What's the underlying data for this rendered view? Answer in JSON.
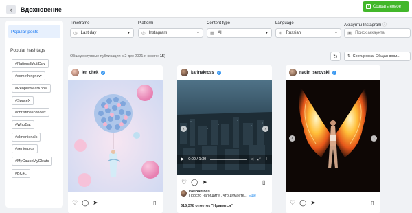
{
  "header": {
    "title": "Вдохновение",
    "create_label": "Создать новое"
  },
  "sidebar": {
    "popular_posts": "Popular posts",
    "hashtags_title": "Popular hashtags",
    "hashtags": [
      "#NationalMuttDay",
      "#somethingnew",
      "#PeopleWearKnow",
      "#SpaceX",
      "#christmasconcert",
      "#WhoBat",
      "#almonienalk",
      "#seniorpics",
      "#MyCauseMyCleats",
      "#BC4L"
    ]
  },
  "filters": {
    "timeframe": {
      "label": "Timeframe",
      "value": "Last day"
    },
    "platform": {
      "label": "Platform",
      "value": "Instagram"
    },
    "content_type": {
      "label": "Content type",
      "value": "All"
    },
    "language": {
      "label": "Language",
      "value": "Russian"
    },
    "accounts": {
      "label": "Аккаунты Instagram",
      "placeholder": "Поиск аккаунта"
    }
  },
  "meta": {
    "text": "Общедоступные публикации с 2 дек 2021 г. (всего: ",
    "count": "15",
    "suffix": ")"
  },
  "sort_label": "Сортировка: Общая вовл...",
  "posts": [
    {
      "username": "ler_chek"
    },
    {
      "username": "karinakross",
      "video_time": "0:00 / 1:30",
      "caption_user": "karinakross",
      "caption_text": "Просто напишите , что думаете...",
      "caption_more": "Еще",
      "likes": "615,378 отметок \"Нравится\""
    },
    {
      "username": "nadin_serovski"
    }
  ],
  "colors": {
    "accent": "#1877f2",
    "create": "#42b72a",
    "verified": "#3897f0"
  }
}
